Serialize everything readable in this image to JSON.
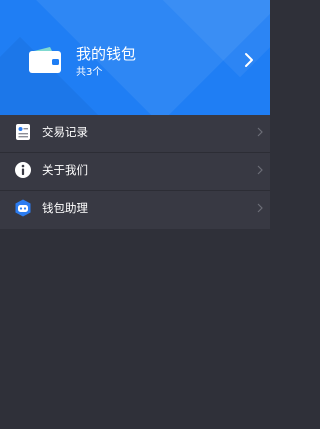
{
  "wallet": {
    "title": "我的钱包",
    "count": "共3个",
    "icon": "wallet-icon",
    "chevron": "chevron-right-icon"
  },
  "menu": {
    "items": [
      {
        "label": "交易记录",
        "icon": "transaction-record-icon"
      },
      {
        "label": "关于我们",
        "icon": "info-icon"
      },
      {
        "label": "钱包助理",
        "icon": "assistant-robot-icon"
      }
    ]
  },
  "colors": {
    "header_blue": "#1f7ef4",
    "menu_bg": "#383943",
    "page_bg": "#2f3039",
    "assistant_blue": "#2b7cf0"
  }
}
